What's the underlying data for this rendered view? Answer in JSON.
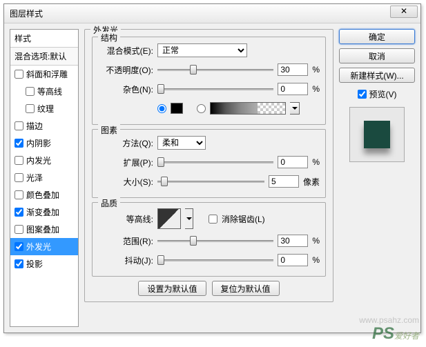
{
  "title": "图层样式",
  "sidebar": {
    "header": "样式",
    "sub": "混合选项:默认",
    "items": [
      {
        "label": "斜面和浮雕",
        "checked": false,
        "indent": false
      },
      {
        "label": "等高线",
        "checked": false,
        "indent": true
      },
      {
        "label": "纹理",
        "checked": false,
        "indent": true
      },
      {
        "label": "描边",
        "checked": false,
        "indent": false
      },
      {
        "label": "内阴影",
        "checked": true,
        "indent": false
      },
      {
        "label": "内发光",
        "checked": false,
        "indent": false
      },
      {
        "label": "光泽",
        "checked": false,
        "indent": false
      },
      {
        "label": "颜色叠加",
        "checked": false,
        "indent": false
      },
      {
        "label": "渐变叠加",
        "checked": true,
        "indent": false
      },
      {
        "label": "图案叠加",
        "checked": false,
        "indent": false
      },
      {
        "label": "外发光",
        "checked": true,
        "indent": false,
        "selected": true
      },
      {
        "label": "投影",
        "checked": true,
        "indent": false
      }
    ]
  },
  "panel_title": "外发光",
  "structure": {
    "legend": "结构",
    "blend_label": "混合模式(E):",
    "blend_value": "正常",
    "opacity_label": "不透明度(O):",
    "opacity_value": "30",
    "opacity_unit": "%",
    "noise_label": "杂色(N):",
    "noise_value": "0",
    "noise_unit": "%"
  },
  "elements": {
    "legend": "图素",
    "method_label": "方法(Q):",
    "method_value": "柔和",
    "spread_label": "扩展(P):",
    "spread_value": "0",
    "spread_unit": "%",
    "size_label": "大小(S):",
    "size_value": "5",
    "size_unit": "像素"
  },
  "quality": {
    "legend": "品质",
    "contour_label": "等高线:",
    "antialias_label": "消除锯齿(L)",
    "range_label": "范围(R):",
    "range_value": "30",
    "range_unit": "%",
    "jitter_label": "抖动(J):",
    "jitter_value": "0",
    "jitter_unit": "%"
  },
  "buttons": {
    "default": "设置为默认值",
    "reset": "复位为默认值",
    "ok": "确定",
    "cancel": "取消",
    "newstyle": "新建样式(W)...",
    "preview": "预览(V)"
  },
  "watermark": {
    "ps": "PS",
    "text": "爱好者",
    "url": "www.psahz.com"
  }
}
